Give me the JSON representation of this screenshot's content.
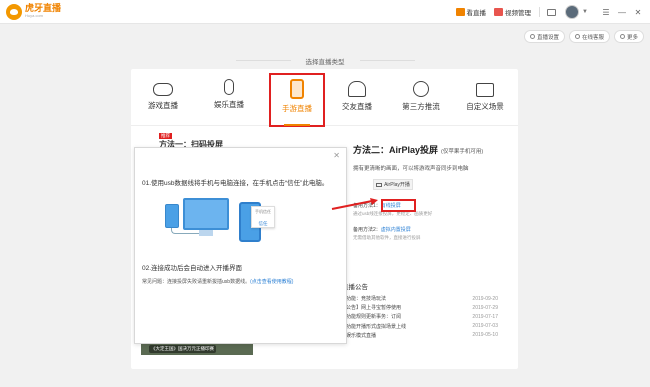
{
  "app": {
    "logo_name": "虎牙直播",
    "logo_sub": "Huya.com"
  },
  "titlebar": {
    "live_button": "看直播",
    "video_button": "视频管理"
  },
  "subtools": {
    "settings": "直播设置",
    "online": "在线客服",
    "more": "更多"
  },
  "page": {
    "type_title": "选择直播类型"
  },
  "categories": [
    {
      "label": "游戏直播"
    },
    {
      "label": "娱乐直播"
    },
    {
      "label": "手游直播",
      "active": true
    },
    {
      "label": "交友直播"
    },
    {
      "label": "第三方推流"
    },
    {
      "label": "自定义场景"
    }
  ],
  "method1": {
    "badge": "推荐",
    "title": "方法一：扫码投屏"
  },
  "method2": {
    "title": "方法二：AirPlay投屏",
    "note": "(仅苹果手机可用)",
    "desc": "拥有更清晰的画面，可以将游戏声音同步到电脑",
    "airplay_button": "AirPlay开播",
    "opt1_label": "备用方法1：",
    "opt1_link": "有线投屏",
    "opt1_desc": "通过usb线连接投屏，更稳定、画质更好",
    "opt2_label": "备用方法2：",
    "opt2_link": "虚拟内置投屏",
    "opt2_desc": "无需借助其他软件，直接进行投屏"
  },
  "notice": {
    "title": "直播公告",
    "items": [
      {
        "text": "新功能：竞技场玩法",
        "date": "2019-09-20"
      },
      {
        "text": "【公告】网上寻宝暂停使用",
        "date": "2019-07-29"
      },
      {
        "text": "新功能规则更新事务：订阅",
        "date": "2019-07-17"
      },
      {
        "text": "新功能开播形式虚拟场景上线",
        "date": "2019-07-03"
      },
      {
        "text": "新娱乐模式直播",
        "date": "2019-05-10"
      }
    ]
  },
  "promo": {
    "label": "《大定王国》国决万元正播印赛"
  },
  "popup": {
    "step1": "01.使用usb数据线将手机与电脑连接，在手机点击“信任”此电脑。",
    "step2": "02.连接成功后会自动进入开播界面",
    "faq_label": "常见问题：连接投屏失败请重新拔插usb数据线。",
    "faq_link": "(点击查看使用教程)",
    "dialog_title": "手机信任",
    "dialog_trust": "信任"
  },
  "colors": {
    "accent": "#f08300",
    "highlight": "#e02020",
    "link": "#2a7fd4"
  }
}
